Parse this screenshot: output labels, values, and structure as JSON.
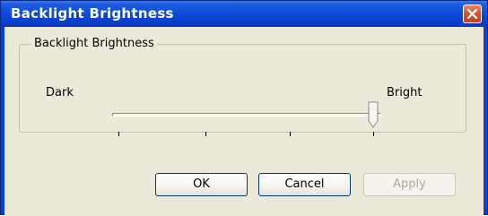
{
  "window": {
    "title": "Backlight Brightness",
    "close_icon": "close-icon"
  },
  "group": {
    "label": "Backlight Brightness"
  },
  "slider": {
    "min_label": "Dark",
    "max_label": "Bright",
    "value_fraction": 1.0,
    "tick_count": 4
  },
  "buttons": {
    "ok": "OK",
    "cancel": "Cancel",
    "apply": "Apply"
  },
  "colors": {
    "titlebar": "#0d4ad8",
    "close": "#d8532d",
    "face": "#ece9d8"
  }
}
